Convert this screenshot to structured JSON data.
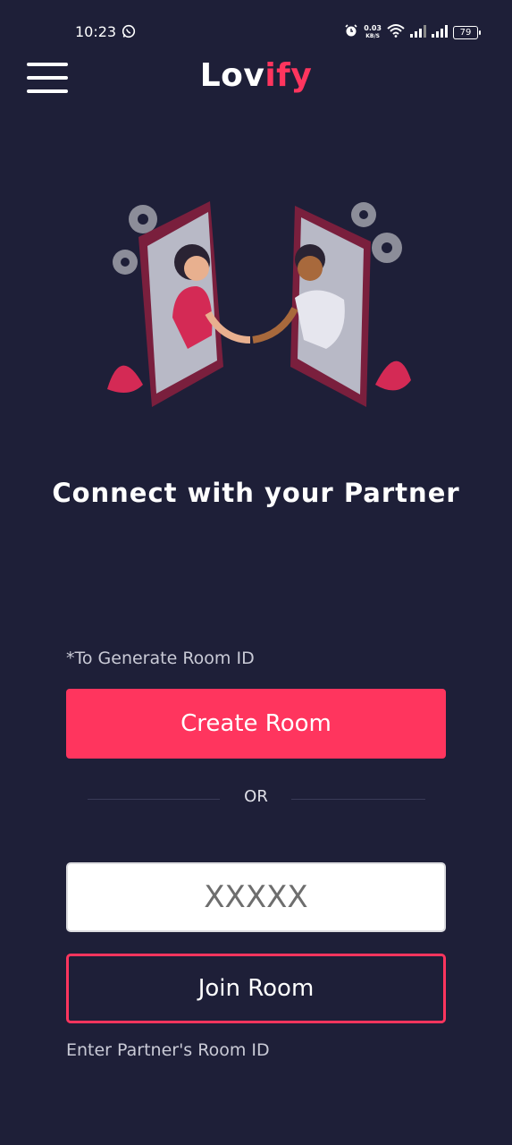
{
  "status_bar": {
    "time": "10:23",
    "network_speed_value": "0.03",
    "network_speed_unit": "KB/S",
    "battery": "79",
    "icons": [
      "whatsapp-icon",
      "alarm-icon",
      "wifi-icon",
      "signal-icon",
      "signal-icon",
      "battery-icon"
    ]
  },
  "header": {
    "logo_part1": "Lov",
    "logo_part2": "ify",
    "menu_icon": "hamburger-menu-icon"
  },
  "colors": {
    "background": "#1e1f38",
    "accent": "#ff355e",
    "text": "#ffffff"
  },
  "main": {
    "illustration": "couple-handshake-phones-illustration",
    "headline": "Connect with your Partner",
    "generate_hint": "*To Generate Room ID",
    "create_button": "Create Room",
    "or_label": "OR",
    "room_input_placeholder": "XXXXX",
    "join_button": "Join Room",
    "join_hint": "Enter Partner's Room ID"
  }
}
